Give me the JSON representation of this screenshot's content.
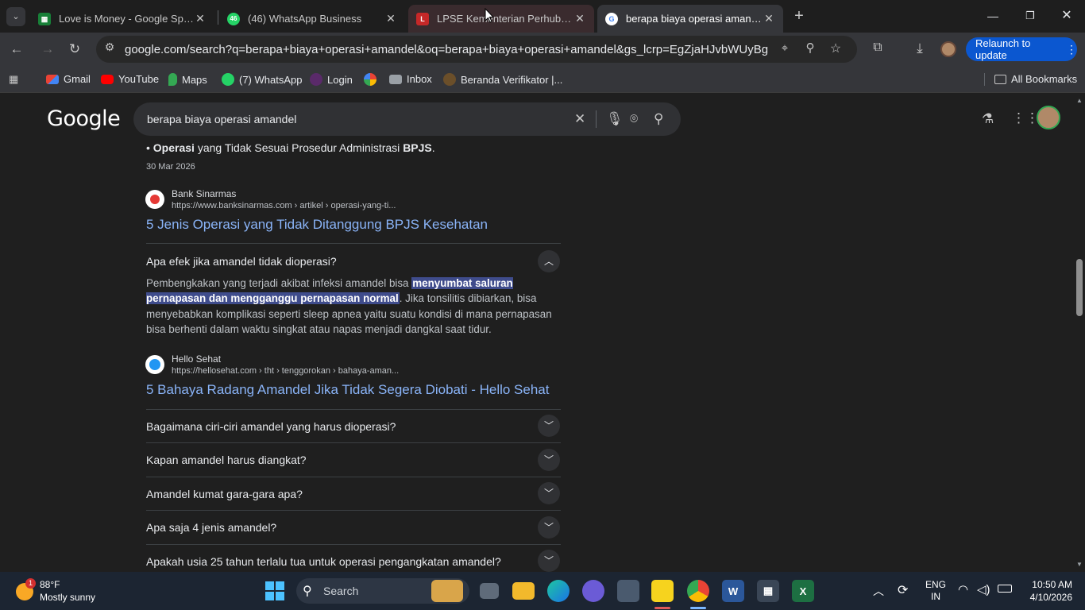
{
  "tabs": [
    {
      "title": "Love is Money - Google Spread",
      "favicon": "sheets-icon"
    },
    {
      "title": "(46) WhatsApp Business",
      "favicon": "whatsapp-icon"
    },
    {
      "title": "LPSE Kementerian Perhubungan",
      "favicon": "lpse-icon"
    },
    {
      "title": "berapa biaya operasi amandel -",
      "favicon": "google-icon"
    }
  ],
  "omnibox": {
    "url": "google.com/search?q=berapa+biaya+operasi+amandel&oq=berapa+biaya+operasi+amandel&gs_lcrp=EgZjaHJvbWUyBggAEEU..."
  },
  "relaunch_label": "Relaunch to update",
  "bookmarks": [
    {
      "label": "Gmail"
    },
    {
      "label": "YouTube"
    },
    {
      "label": "Maps"
    },
    {
      "label": "(7) WhatsApp"
    },
    {
      "label": "Login"
    },
    {
      "label": "Inbox"
    },
    {
      "label": "Beranda Verifikator |..."
    }
  ],
  "all_bookmarks": "All Bookmarks",
  "google_logo": "Google",
  "search": {
    "query": "berapa biaya operasi amandel"
  },
  "snippet": {
    "bold1": "Operasi",
    "middle": " yang Tidak Sesuai Prosedur Administrasi ",
    "bold2": "BPJS",
    "end": ".",
    "date": "30 Mar 2026"
  },
  "result1": {
    "source": "Bank Sinarmas",
    "url": "https://www.banksinarmas.com › artikel › operasi-yang-ti...",
    "title": "5 Jenis Operasi yang Tidak Ditanggung BPJS Kesehatan"
  },
  "faq_open": {
    "question": "Apa efek jika amandel tidak dioperasi?",
    "answer_pre": "Pembengkakan yang terjadi akibat infeksi amandel bisa ",
    "answer_highlight": "menyumbat saluran pernapasan dan mengganggu pernapasan normal",
    "answer_post": ". Jika tonsilitis dibiarkan, bisa menyebabkan komplikasi seperti sleep apnea yaitu suatu kondisi di mana pernapasan bisa berhenti dalam waktu singkat atau napas menjadi dangkal saat tidur."
  },
  "result2": {
    "source": "Hello Sehat",
    "url": "https://hellosehat.com › tht › tenggorokan › bahaya-aman...",
    "title": "5 Bahaya Radang Amandel Jika Tidak Segera Diobati - Hello Sehat"
  },
  "faqs": [
    "Bagaimana ciri-ciri amandel yang harus dioperasi?",
    "Kapan amandel harus diangkat?",
    "Amandel kumat gara-gara apa?",
    "Apa saja 4 jenis amandel?",
    "Apakah usia 25 tahun terlalu tua untuk operasi pengangkatan amandel?"
  ],
  "taskbar": {
    "weather_temp": "88°F",
    "weather_desc": "Mostly sunny",
    "weather_badge": "1",
    "search_placeholder": "Search",
    "lang1": "ENG",
    "lang2": "IN",
    "time": "10:50 AM",
    "date": "4/10/2026"
  }
}
